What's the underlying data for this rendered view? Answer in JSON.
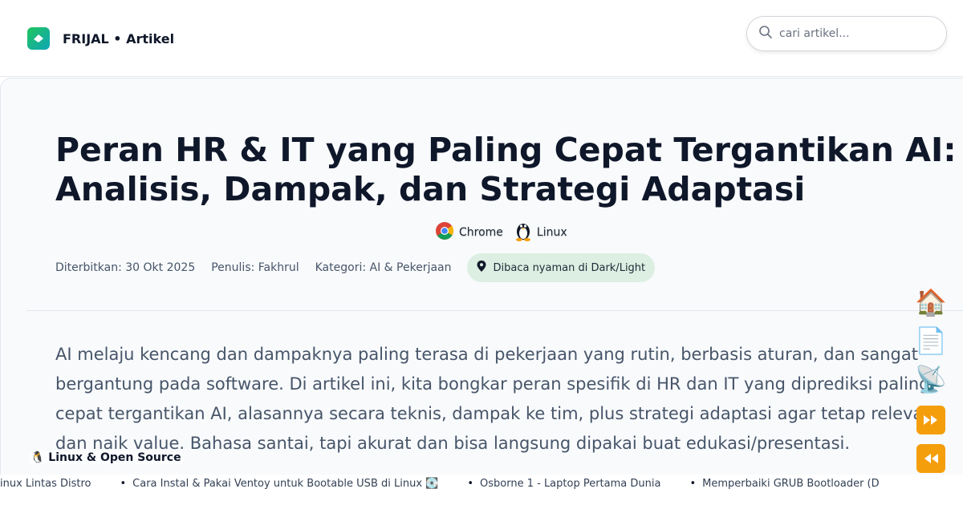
{
  "header": {
    "brand": "FRIJAL • Artikel",
    "search_placeholder": "cari artikel..."
  },
  "article": {
    "title_line1": "Peran HR & IT yang Paling Cepat Tergantikan AI:",
    "title_line2": "Analisis, Dampak, dan Strategi Adaptasi",
    "platforms": [
      {
        "label": "Chrome",
        "icon": "chrome-icon"
      },
      {
        "label": "Linux",
        "icon": "tux-icon"
      }
    ],
    "meta": {
      "published": "Diterbitkan: 30 Okt 2025",
      "author": "Penulis: Fakhrul",
      "category": "Kategori: AI & Pekerjaan",
      "theme_note": "Dibaca nyaman di Dark/Light"
    },
    "intro": "AI melaju kencang dan dampaknya paling terasa di pekerjaan yang rutin, berbasis aturan, dan sangat bergantung pada software. Di artikel ini, kita bongkar peran spesifik di HR dan IT yang diprediksi paling cepat tergantikan AI, alasannya secara teknis, dampak ke tim, plus strategi adaptasi agar tetap relevan dan naik value. Bahasa santai, tapi akurat dan bisa langsung dipakai buat edukasi/presentasi."
  },
  "side_nav": {
    "home": "🏠",
    "document": "📄",
    "feed": "📡",
    "forward": "⏩",
    "back": "⏪"
  },
  "ticker": {
    "label": "🐧 Linux & Open Source",
    "items": [
      "an Mirror Linux Lintas Distro",
      "Cara Instal & Pakai Ventoy untuk Bootable USB di Linux 💽",
      "Osborne 1 - Laptop Pertama Dunia",
      "Memperbaiki GRUB Bootloader (D"
    ]
  },
  "colors": {
    "accent_green": "#22c55e",
    "pill_bg": "#dcefe2",
    "side_button": "#f59e0b"
  }
}
